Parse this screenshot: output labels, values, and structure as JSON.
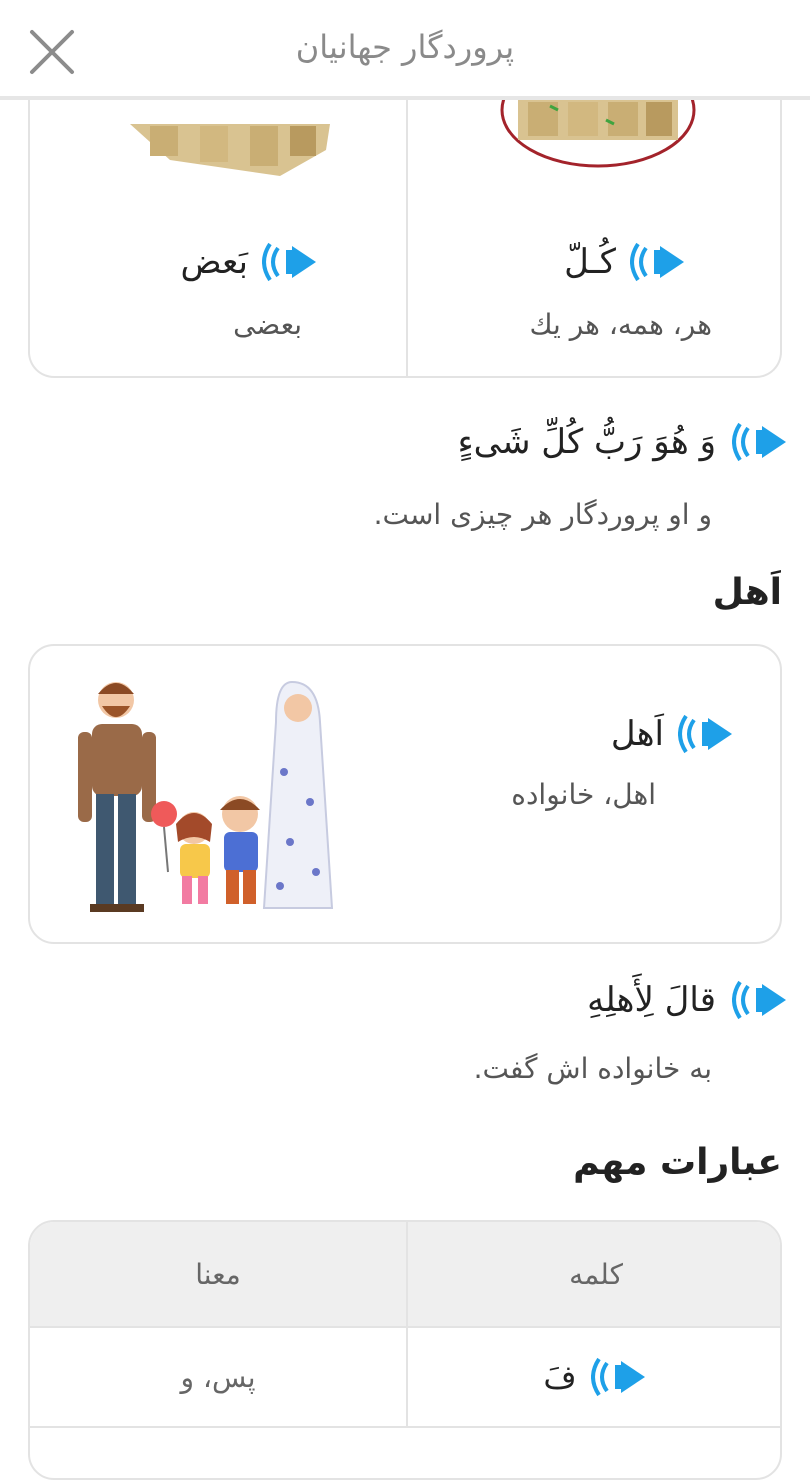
{
  "header": {
    "title": "پروردگار جهانیان"
  },
  "top_card": {
    "right": {
      "arabic": "كُـلّ",
      "meaning": "هر، همه، هر يك"
    },
    "left": {
      "arabic": "بَعض",
      "meaning": "بعضی"
    }
  },
  "sentence1": {
    "arabic": "وَ هُوَ رَبُّ كُلِّ شَیءٍ",
    "translation": "و او پروردگار هر چیزی است."
  },
  "section_ahl": {
    "title": "اَهل",
    "card": {
      "arabic": "اَهل",
      "meaning": "اهل، خانواده"
    }
  },
  "sentence2": {
    "arabic": "قالَ لِأَهلِهِ",
    "translation": "به خانواده اش گفت."
  },
  "section_phrases": {
    "title": "عبارات مهم",
    "table": {
      "headers": {
        "word": "كلمه",
        "meaning": "معنا"
      },
      "rows": [
        {
          "word": "فَ",
          "meaning": "پس، و"
        }
      ]
    }
  },
  "colors": {
    "accent": "#1ea0e8",
    "border": "#e3e3e3"
  }
}
